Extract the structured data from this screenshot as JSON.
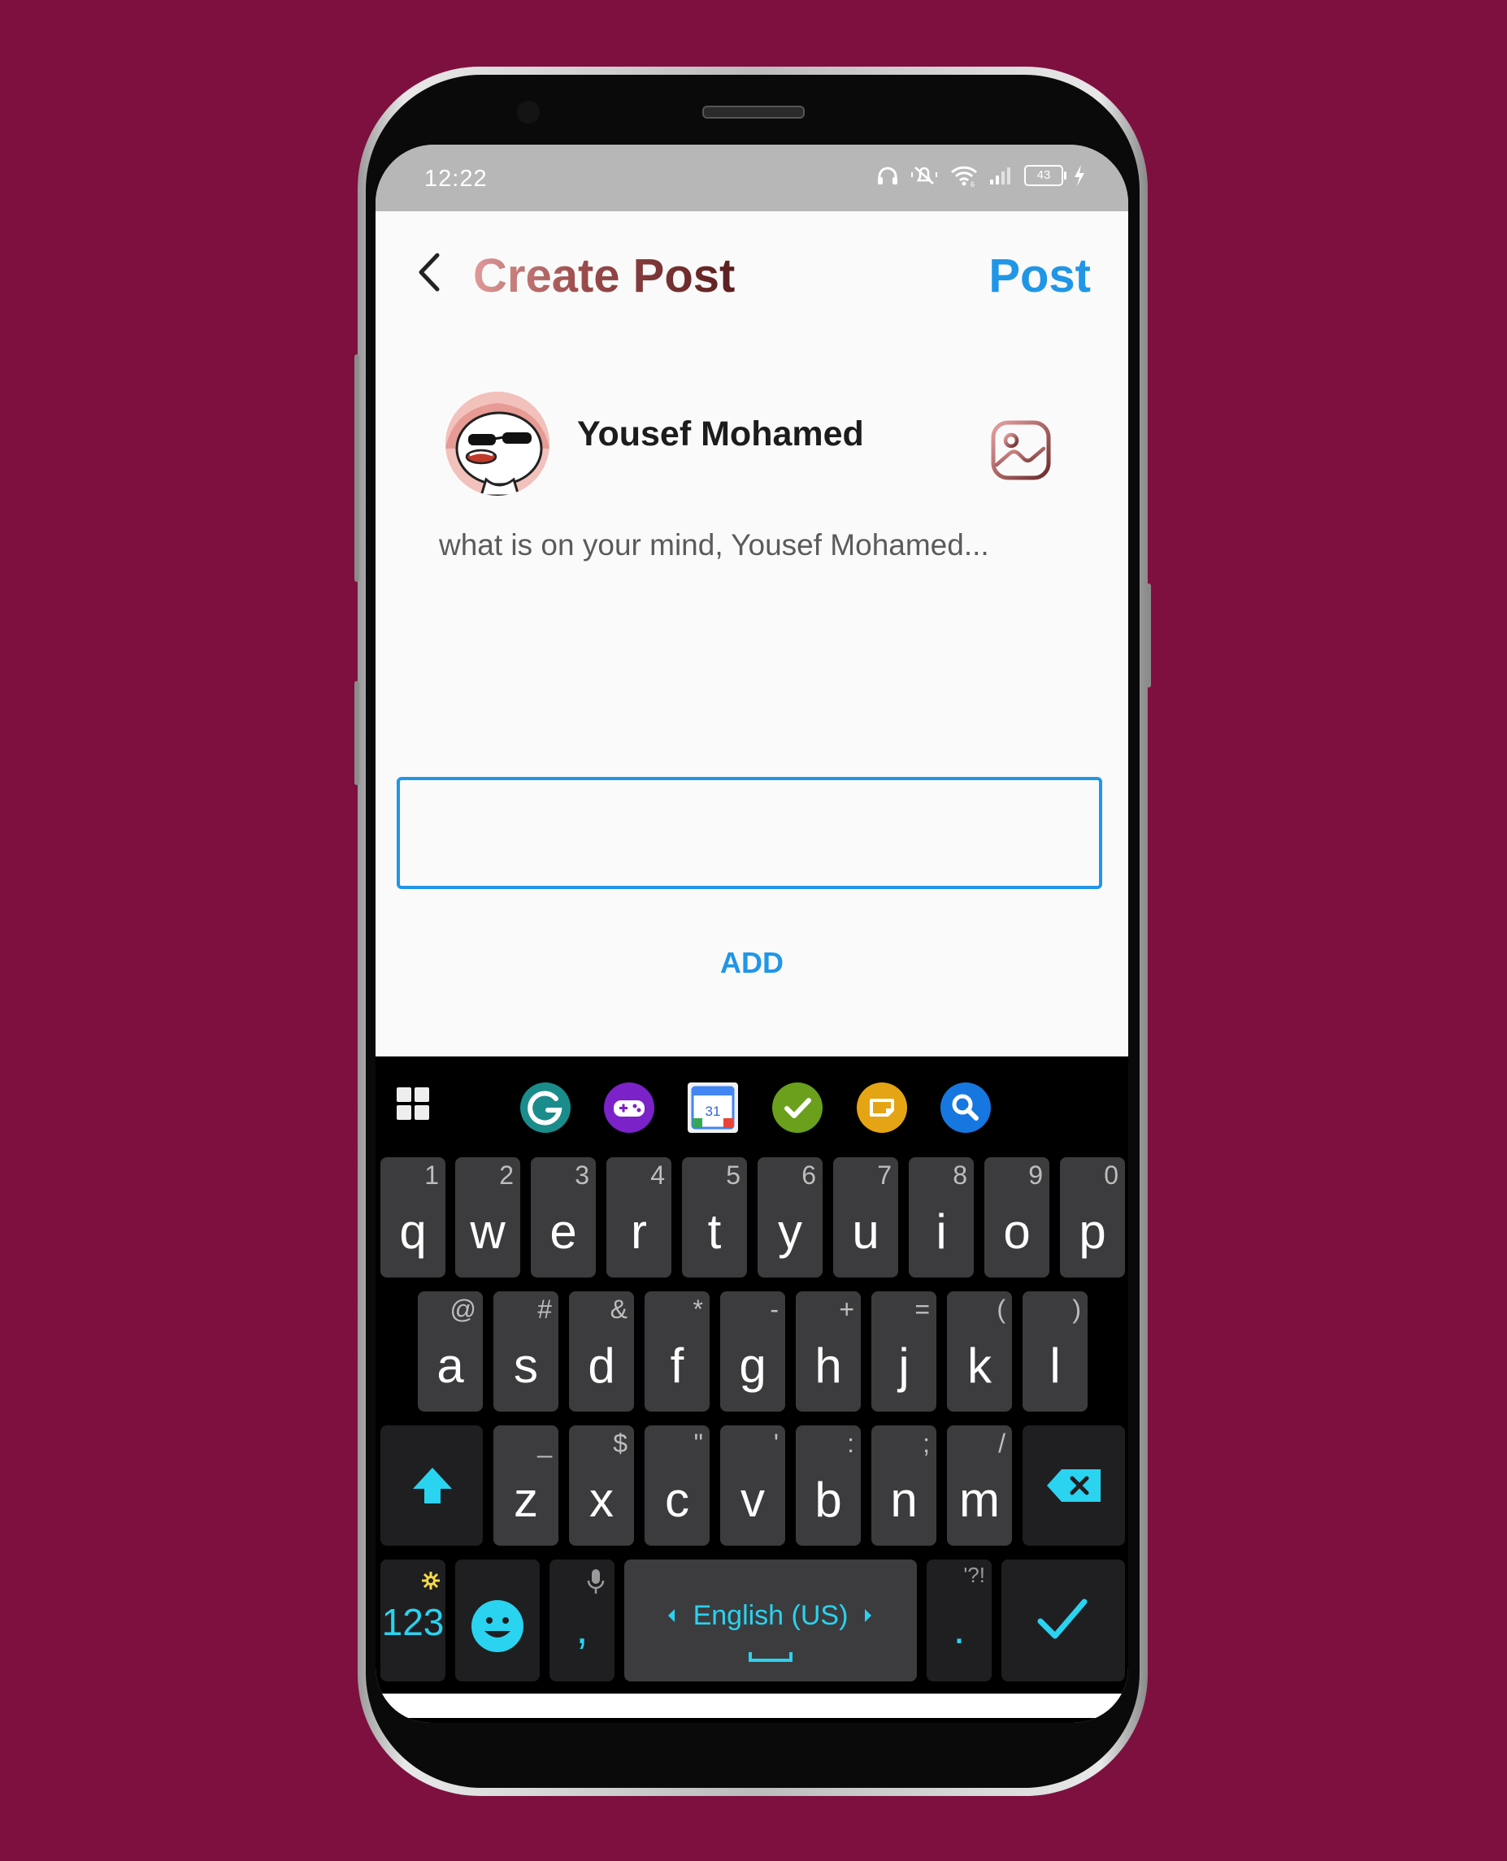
{
  "status_bar": {
    "time": "12:22",
    "battery": "43",
    "icons": [
      "headphones-icon",
      "mute-icon",
      "wifi-icon",
      "signal-icon",
      "battery-icon",
      "charging-icon"
    ]
  },
  "header": {
    "title": "Create Post",
    "post_label": "Post"
  },
  "user": {
    "name": "Yousef Mohamed"
  },
  "composer": {
    "prompt": "what is on your mind, Yousef Mohamed...",
    "input_value": "",
    "add_label": "ADD"
  },
  "colors": {
    "background": "#7e1040",
    "accent": "#2196e6",
    "keyboard_accent": "#2ad3f0"
  },
  "keyboard": {
    "toolbar": [
      "apps-grid-icon",
      "grammarly-icon",
      "games-icon",
      "calendar-icon",
      "checkmark-icon",
      "sticker-icon",
      "search-icon"
    ],
    "calendar_day": "31",
    "row1": [
      {
        "k": "q",
        "h": "1"
      },
      {
        "k": "w",
        "h": "2"
      },
      {
        "k": "e",
        "h": "3"
      },
      {
        "k": "r",
        "h": "4"
      },
      {
        "k": "t",
        "h": "5"
      },
      {
        "k": "y",
        "h": "6"
      },
      {
        "k": "u",
        "h": "7"
      },
      {
        "k": "i",
        "h": "8"
      },
      {
        "k": "o",
        "h": "9"
      },
      {
        "k": "p",
        "h": "0"
      }
    ],
    "row2": [
      {
        "k": "a",
        "h": "@"
      },
      {
        "k": "s",
        "h": "#"
      },
      {
        "k": "d",
        "h": "&"
      },
      {
        "k": "f",
        "h": "*"
      },
      {
        "k": "g",
        "h": "-"
      },
      {
        "k": "h",
        "h": "+"
      },
      {
        "k": "j",
        "h": "="
      },
      {
        "k": "k",
        "h": "("
      },
      {
        "k": "l",
        "h": ")"
      }
    ],
    "row3": [
      {
        "k": "z",
        "h": "_"
      },
      {
        "k": "x",
        "h": "$"
      },
      {
        "k": "c",
        "h": "\""
      },
      {
        "k": "v",
        "h": "'"
      },
      {
        "k": "b",
        "h": ":"
      },
      {
        "k": "n",
        "h": ";"
      },
      {
        "k": "m",
        "h": "/"
      }
    ],
    "numbers_label": "123",
    "comma": ",",
    "language": "English (US)",
    "period": ".",
    "period_hint": "'?!"
  }
}
